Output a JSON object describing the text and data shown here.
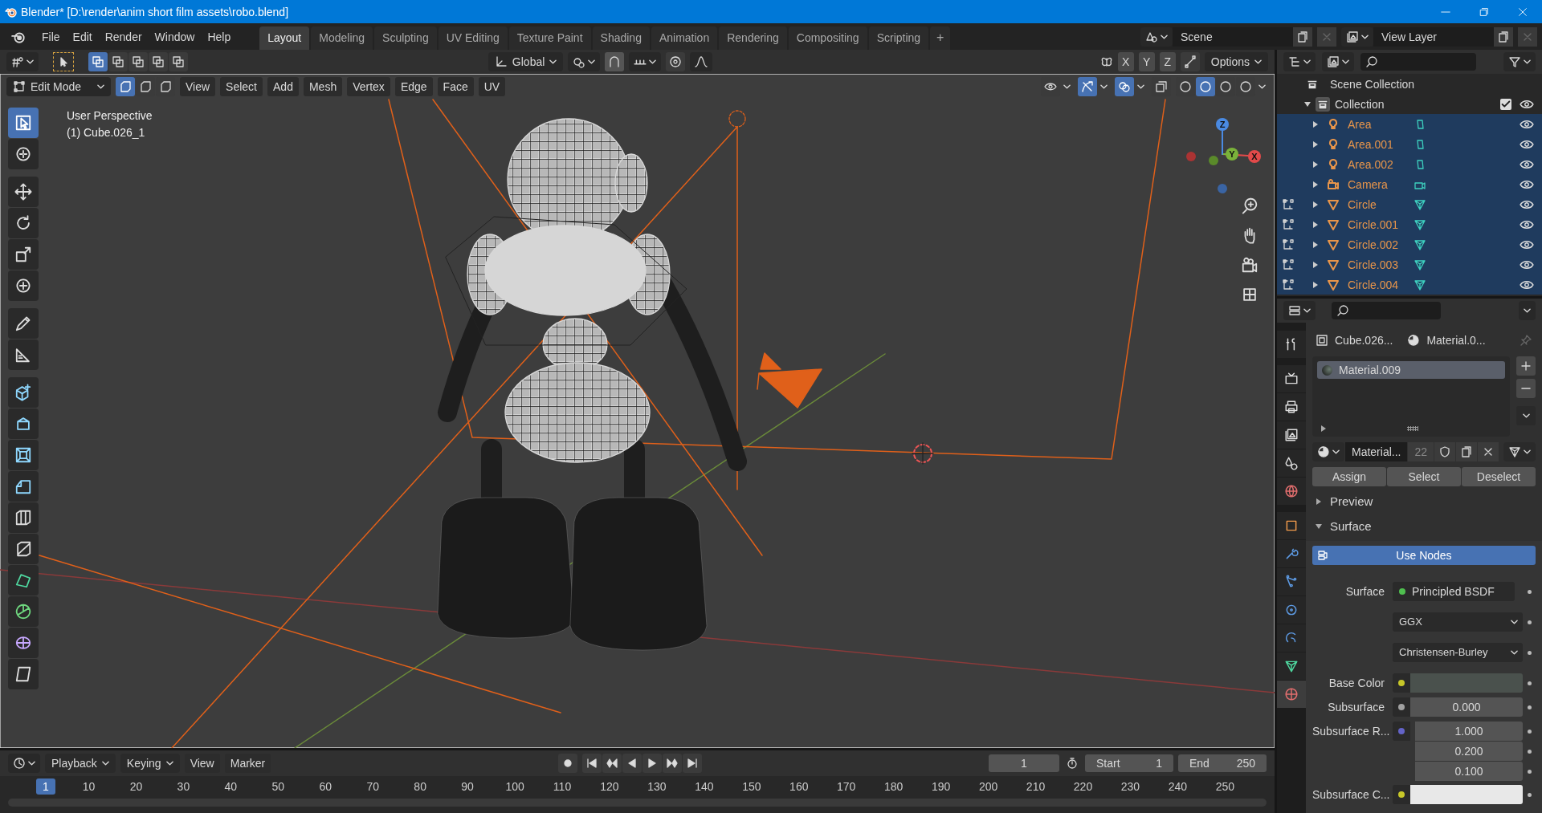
{
  "window": {
    "title": "Blender* [D:\\render\\anim short film assets\\robo.blend]"
  },
  "top_bar": {
    "menus": [
      "File",
      "Edit",
      "Render",
      "Window",
      "Help"
    ],
    "workspaces": [
      {
        "label": "Layout",
        "selected": true
      },
      {
        "label": "Modeling",
        "selected": false
      },
      {
        "label": "Sculpting",
        "selected": false
      },
      {
        "label": "UV Editing",
        "selected": false
      },
      {
        "label": "Texture Paint",
        "selected": false
      },
      {
        "label": "Shading",
        "selected": false
      },
      {
        "label": "Animation",
        "selected": false
      },
      {
        "label": "Rendering",
        "selected": false
      },
      {
        "label": "Compositing",
        "selected": false
      },
      {
        "label": "Scripting",
        "selected": false
      }
    ],
    "add_tab": "+",
    "scene": "Scene",
    "view_layer": "View Layer"
  },
  "tool_header": {
    "select_modes": [
      {
        "selected": true
      },
      {
        "selected": false
      },
      {
        "selected": false
      },
      {
        "selected": false
      },
      {
        "selected": false
      }
    ],
    "orientation": "Global",
    "axes": [
      {
        "label": "X",
        "selected": false
      },
      {
        "label": "Y",
        "selected": false
      },
      {
        "label": "Z",
        "selected": false
      }
    ],
    "options": "Options"
  },
  "viewport_header": {
    "mode": "Edit Mode",
    "element_modes": [
      {
        "selected": true
      },
      {
        "selected": false
      },
      {
        "selected": false
      }
    ],
    "menus": [
      "View",
      "Select",
      "Add",
      "Mesh",
      "Vertex",
      "Edge",
      "Face",
      "UV"
    ],
    "toggles": [
      {
        "kind": "visibility",
        "selected": false
      },
      {
        "kind": "gizmo",
        "selected": true
      },
      {
        "kind": "overlay",
        "selected": true
      },
      {
        "kind": "xray",
        "selected": false
      }
    ],
    "shading": [
      {
        "selected": false
      },
      {
        "selected": true
      },
      {
        "selected": false
      },
      {
        "selected": false
      }
    ]
  },
  "viewport": {
    "perspective": "User Perspective",
    "object": "(1) Cube.026_1",
    "gizmo_labels": [
      "X",
      "Y",
      "Z"
    ],
    "tools": [
      {
        "kind": "select",
        "selected": true
      },
      {
        "kind": "cursor",
        "selected": false
      },
      {
        "kind": "move",
        "selected": false
      },
      {
        "kind": "rotate",
        "selected": false
      },
      {
        "kind": "scale",
        "selected": false
      },
      {
        "kind": "transform",
        "selected": false
      },
      {
        "kind": "annotate",
        "selected": false
      },
      {
        "kind": "measure",
        "selected": false
      },
      {
        "kind": "add_cube",
        "selected": false
      },
      {
        "kind": "extrude",
        "selected": false
      },
      {
        "kind": "inset",
        "selected": false
      },
      {
        "kind": "bevel",
        "selected": false
      },
      {
        "kind": "loop_cut",
        "selected": false
      },
      {
        "kind": "knife",
        "selected": false
      },
      {
        "kind": "poly_build",
        "selected": false
      },
      {
        "kind": "spin",
        "selected": false
      },
      {
        "kind": "smooth",
        "selected": false
      },
      {
        "kind": "shear",
        "selected": false
      }
    ]
  },
  "timeline": {
    "menus": [
      "Playback",
      "Keying",
      "View",
      "Marker"
    ],
    "current_frame": "1",
    "start_label": "Start",
    "start": "1",
    "end_label": "End",
    "end": "250",
    "marker": "1",
    "frames": [
      "10",
      "20",
      "30",
      "40",
      "50",
      "60",
      "70",
      "80",
      "90",
      "100",
      "110",
      "120",
      "130",
      "140",
      "150",
      "160",
      "170",
      "180",
      "190",
      "200",
      "210",
      "220",
      "230",
      "240",
      "250"
    ]
  },
  "outliner": {
    "root": "Scene Collection",
    "collection": {
      "label": "Collection",
      "checked": true,
      "expanded": true,
      "selected": false,
      "children": [
        {
          "name": "Area",
          "kind": "light",
          "selected": true,
          "expanded": false
        },
        {
          "name": "Area.001",
          "kind": "light",
          "selected": true,
          "expanded": false
        },
        {
          "name": "Area.002",
          "kind": "light",
          "selected": true,
          "expanded": false
        },
        {
          "name": "Camera",
          "kind": "camera",
          "selected": true,
          "expanded": false
        },
        {
          "name": "Circle",
          "kind": "mesh",
          "selected": true,
          "expanded": false
        },
        {
          "name": "Circle.001",
          "kind": "mesh",
          "selected": true,
          "expanded": false
        },
        {
          "name": "Circle.002",
          "kind": "mesh",
          "selected": true,
          "expanded": false
        },
        {
          "name": "Circle.003",
          "kind": "mesh",
          "selected": true,
          "expanded": false
        },
        {
          "name": "Circle.004",
          "kind": "mesh",
          "selected": true,
          "expanded": false
        }
      ]
    }
  },
  "properties": {
    "tabs": [
      {
        "kind": "tool",
        "selected": false
      },
      {
        "kind": "render",
        "selected": false
      },
      {
        "kind": "output",
        "selected": false
      },
      {
        "kind": "view_layer",
        "selected": false
      },
      {
        "kind": "scene",
        "selected": false
      },
      {
        "kind": "world",
        "selected": false
      },
      {
        "kind": "object",
        "selected": false
      },
      {
        "kind": "modifier",
        "selected": false
      },
      {
        "kind": "particles",
        "selected": false
      },
      {
        "kind": "physics",
        "selected": false
      },
      {
        "kind": "constraint",
        "selected": false
      },
      {
        "kind": "data",
        "selected": false
      },
      {
        "kind": "material",
        "selected": true
      }
    ],
    "object": "Cube.026...",
    "material": "Material.0...",
    "slots": [
      {
        "name": "Material.009",
        "selected": true
      }
    ],
    "material_name": "Material...",
    "users": "22",
    "actions": [
      "Assign",
      "Select",
      "Deselect"
    ],
    "panels": [
      {
        "label": "Preview",
        "expanded": false
      },
      {
        "label": "Surface",
        "expanded": true
      }
    ],
    "use_nodes": {
      "label": "Use Nodes",
      "on": true
    },
    "fields": [
      {
        "kind": "link",
        "label": "Surface",
        "value": "Principled BSDF",
        "color": "#4fbf4f"
      },
      {
        "kind": "enum",
        "value": "GGX"
      },
      {
        "kind": "enum",
        "value": "Christensen-Burley"
      },
      {
        "kind": "color",
        "label": "Base Color",
        "color": "#c7c729",
        "swatch": {
          "color": "#4a514d"
        }
      },
      {
        "kind": "number",
        "label": "Subsurface",
        "color": "#a1a1a1",
        "value": "0.000"
      },
      {
        "kind": "vector",
        "label": "Subsurface R...",
        "color": "#6363c7",
        "values": [
          "1.000",
          "0.200",
          "0.100"
        ]
      },
      {
        "kind": "color",
        "label": "Subsurface C...",
        "color": "#c7c729",
        "swatch": {
          "color": "#e8e8e8"
        }
      }
    ]
  }
}
